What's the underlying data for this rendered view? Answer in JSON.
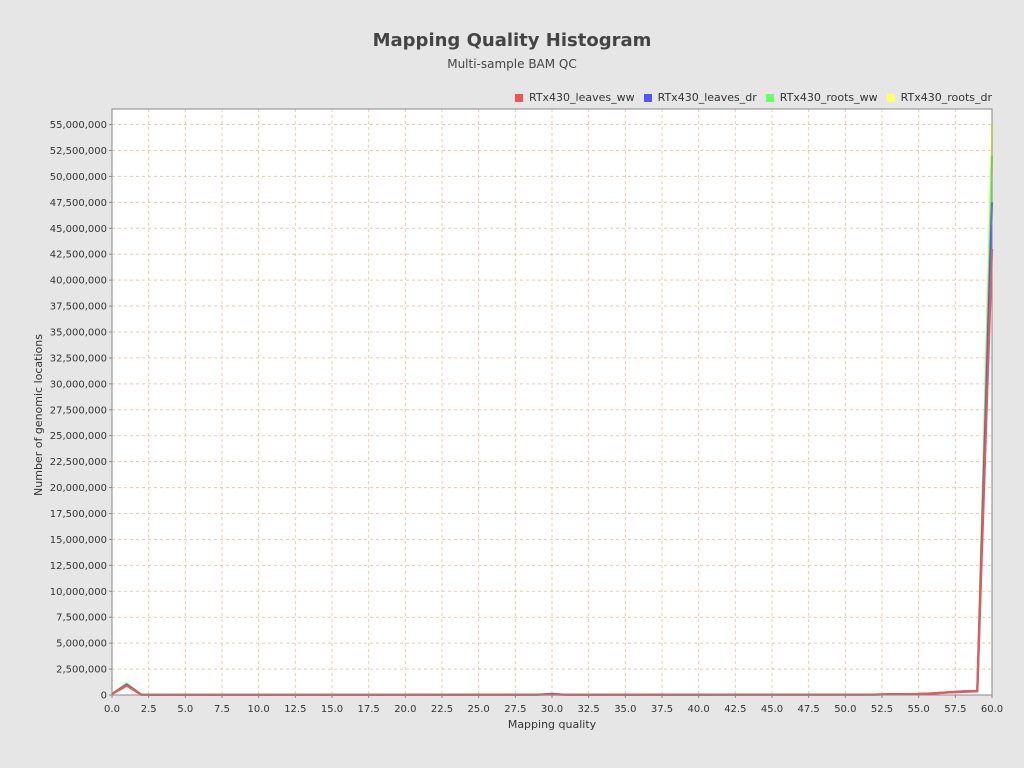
{
  "chart_data": {
    "type": "line",
    "title": "Mapping Quality Histogram",
    "subtitle": "Multi-sample BAM QC",
    "xlabel": "Mapping quality",
    "ylabel": "Number of genomic locations",
    "xlim": [
      0,
      60
    ],
    "ylim": [
      0,
      56500000
    ],
    "x_tick_step": 2.5,
    "y_tick_step": 2500000,
    "grid": true,
    "legend_position": "top-right",
    "colors": {
      "background": "#e6e6e6",
      "plot_background": "#ffffff",
      "gridline": "#f4c8b0"
    },
    "series": [
      {
        "name": "RTx430_roots_dr",
        "color": "#ffff66",
        "points": [
          [
            0,
            100000
          ],
          [
            1,
            1150000
          ],
          [
            2,
            30000
          ],
          [
            3,
            20000
          ],
          [
            10,
            20000
          ],
          [
            20,
            20000
          ],
          [
            29,
            30000
          ],
          [
            30,
            90000
          ],
          [
            31,
            20000
          ],
          [
            52,
            40000
          ],
          [
            53,
            80000
          ],
          [
            55,
            100000
          ],
          [
            56,
            150000
          ],
          [
            57,
            250000
          ],
          [
            58,
            350000
          ],
          [
            59,
            400000
          ],
          [
            60,
            55000000
          ]
        ]
      },
      {
        "name": "RTx430_roots_ww",
        "color": "#66ff66",
        "points": [
          [
            0,
            100000
          ],
          [
            1,
            1100000
          ],
          [
            2,
            30000
          ],
          [
            3,
            20000
          ],
          [
            10,
            20000
          ],
          [
            20,
            20000
          ],
          [
            29,
            30000
          ],
          [
            30,
            80000
          ],
          [
            31,
            20000
          ],
          [
            52,
            40000
          ],
          [
            53,
            80000
          ],
          [
            55,
            100000
          ],
          [
            56,
            150000
          ],
          [
            57,
            250000
          ],
          [
            58,
            330000
          ],
          [
            59,
            380000
          ],
          [
            60,
            52000000
          ]
        ]
      },
      {
        "name": "RTx430_leaves_dr",
        "color": "#5555ff",
        "points": [
          [
            0,
            100000
          ],
          [
            1,
            1000000
          ],
          [
            2,
            30000
          ],
          [
            3,
            20000
          ],
          [
            10,
            20000
          ],
          [
            20,
            20000
          ],
          [
            29,
            30000
          ],
          [
            30,
            110000
          ],
          [
            31,
            20000
          ],
          [
            52,
            40000
          ],
          [
            53,
            80000
          ],
          [
            55,
            100000
          ],
          [
            56,
            150000
          ],
          [
            57,
            250000
          ],
          [
            58,
            350000
          ],
          [
            59,
            380000
          ],
          [
            60,
            47500000
          ]
        ]
      },
      {
        "name": "RTx430_leaves_ww",
        "color": "#ee5555",
        "points": [
          [
            0,
            100000
          ],
          [
            1,
            900000
          ],
          [
            2,
            30000
          ],
          [
            3,
            20000
          ],
          [
            10,
            20000
          ],
          [
            20,
            20000
          ],
          [
            29,
            30000
          ],
          [
            30,
            60000
          ],
          [
            31,
            20000
          ],
          [
            52,
            40000
          ],
          [
            53,
            80000
          ],
          [
            55,
            100000
          ],
          [
            56,
            150000
          ],
          [
            57,
            250000
          ],
          [
            58,
            300000
          ],
          [
            59,
            350000
          ],
          [
            60,
            43000000
          ]
        ]
      }
    ],
    "legend_order": [
      "RTx430_leaves_ww",
      "RTx430_leaves_dr",
      "RTx430_roots_ww",
      "RTx430_roots_dr"
    ]
  }
}
